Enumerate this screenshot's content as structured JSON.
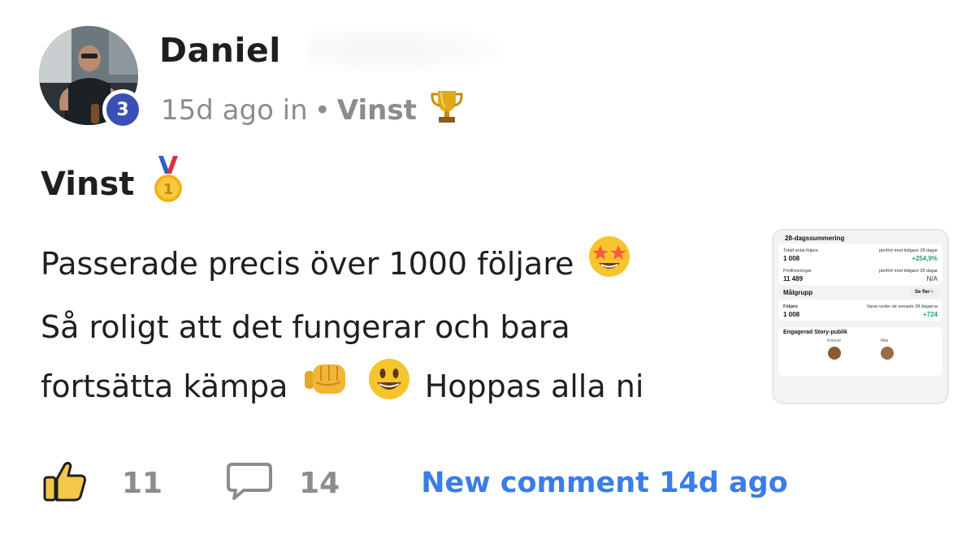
{
  "author": {
    "name": "Daniel",
    "level": "3"
  },
  "meta": {
    "time": "15d ago in",
    "separator": "•",
    "category": "Vinst",
    "category_icon": "trophy-icon"
  },
  "post": {
    "title": "Vinst",
    "title_icon": "first-place-medal-icon",
    "body_line1": "Passerade precis över 1000 följare",
    "body_line2": "Så roligt att det fungerar och bara",
    "body_line3a": "fortsätta kämpa",
    "body_line3b": "Hoppas alla ni",
    "emojis": [
      "star-struck-emoji",
      "fist-bump-emoji",
      "grinning-face-emoji"
    ]
  },
  "attachment": {
    "summary_title": "28-dagssummering",
    "total_followers_label": "Totalt antal följare",
    "compare_label": "jämfört med tidigare 28 dagar",
    "total_followers_value": "1 008",
    "total_followers_change": "+254,9%",
    "profile_views_label": "Profilvisningar",
    "profile_views_value": "11 489",
    "profile_views_change": "N/A",
    "audience_title": "Målgrupp",
    "see_more": "Se fler ›",
    "followers_label": "Följare",
    "followers_sub": "Varav under de senaste 28 dagarna",
    "followers_value": "1 008",
    "followers_change": "+724",
    "story_title": "Engagerad Story-publik",
    "women_label": "Kvinnor",
    "men_label": "Män"
  },
  "actions": {
    "likes": "11",
    "comments": "14",
    "new_comment": "New comment 14d ago"
  },
  "colors": {
    "badge": "#3a4fb5",
    "link": "#3a7de8",
    "muted": "#8c8c8c",
    "text": "#1f1f1f",
    "positive": "#22a36a"
  }
}
